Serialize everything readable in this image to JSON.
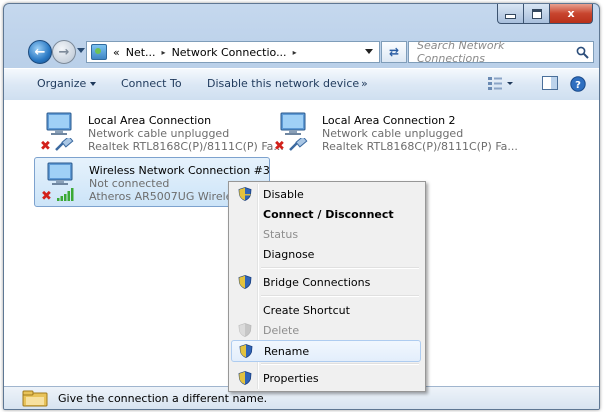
{
  "window": {
    "caption_buttons": {
      "minimize": "minimize",
      "maximize": "maximize",
      "close": "x"
    }
  },
  "address": {
    "segments": [
      "«",
      "Net...",
      "▸",
      "Network Connectio...",
      "▸"
    ],
    "search_placeholder": "Search Network Connections"
  },
  "toolbar": {
    "organize": "Organize",
    "connect_to": "Connect To",
    "disable_device": "Disable this network device",
    "more": "»"
  },
  "connections": [
    {
      "name": "Local Area Connection",
      "status": "Network cable unplugged",
      "device": "Realtek RTL8168C(P)/8111C(P) Fa...",
      "type": "ethernet",
      "selected": false
    },
    {
      "name": "Local Area Connection 2",
      "status": "Network cable unplugged",
      "device": "Realtek RTL8168C(P)/8111C(P) Fa...",
      "type": "ethernet",
      "selected": false
    },
    {
      "name": "Wireless Network Connection #3",
      "status": "Not connected",
      "device": "Atheros AR5007UG Wireless N",
      "type": "wireless",
      "selected": true
    }
  ],
  "context_menu": {
    "items": [
      {
        "label": "Disable",
        "shield": true,
        "style": "normal"
      },
      {
        "label": "Connect / Disconnect",
        "shield": false,
        "style": "bold"
      },
      {
        "label": "Status",
        "shield": false,
        "style": "dim"
      },
      {
        "label": "Diagnose",
        "shield": false,
        "style": "normal"
      },
      {
        "label": "Bridge Connections",
        "shield": true,
        "style": "normal"
      },
      {
        "label": "Create Shortcut",
        "shield": false,
        "style": "normal"
      },
      {
        "label": "Delete",
        "shield": true,
        "style": "dim"
      },
      {
        "label": "Rename",
        "shield": true,
        "style": "highlighted"
      },
      {
        "label": "Properties",
        "shield": true,
        "style": "normal"
      }
    ]
  },
  "statusbar": {
    "text": "Give the connection a different name."
  },
  "colors": {
    "accent": "#2a79c4",
    "selection": "#cce4f8",
    "error_x": "#d2211b",
    "signal": "#3aa935"
  }
}
